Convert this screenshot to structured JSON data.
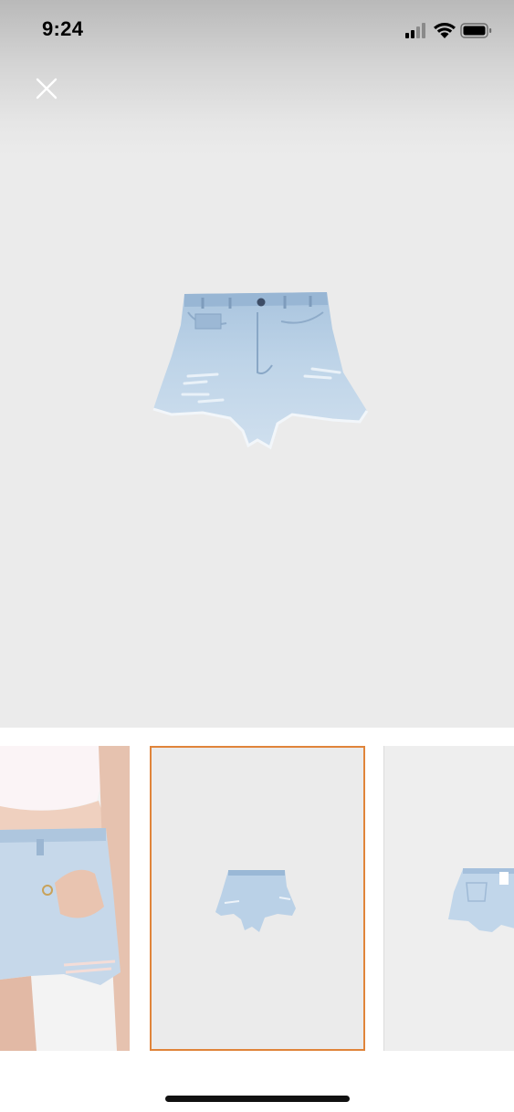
{
  "status_bar": {
    "time": "9:24",
    "icons": [
      "cellular-signal-icon",
      "wifi-icon",
      "battery-icon"
    ]
  },
  "viewer": {
    "close_icon": "close-icon",
    "main_image": "light-wash-distressed-denim-shorts-front"
  },
  "thumbnails": [
    {
      "image": "model-wearing-denim-shorts",
      "selected": false
    },
    {
      "image": "denim-shorts-front",
      "selected": true
    },
    {
      "image": "denim-shorts-back",
      "selected": false
    }
  ],
  "colors": {
    "selected_border": "#e0843a",
    "denim": "#b8cfe3",
    "background": "#ebebeb"
  }
}
